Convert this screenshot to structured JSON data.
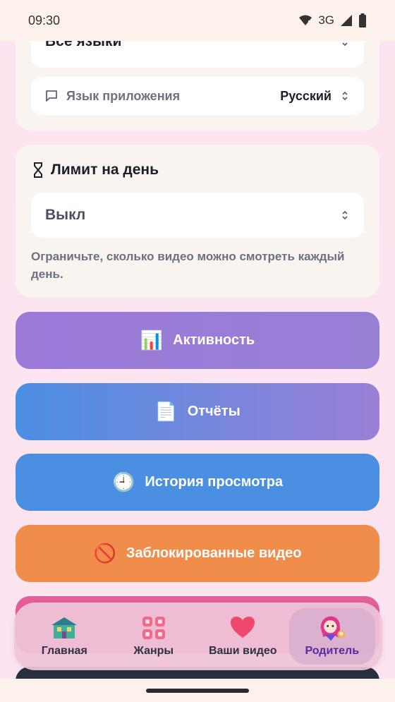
{
  "status_bar": {
    "time": "09:30",
    "network": "3G"
  },
  "language_card": {
    "content_language_value": "Все языки",
    "app_language_label": "Язык приложения",
    "app_language_value": "Русский"
  },
  "limit_card": {
    "title": "Лимит на день",
    "value": "Выкл",
    "hint": "Ограничьте, сколько видео можно смотреть каждый день."
  },
  "buttons": [
    {
      "icon": "📊",
      "label": "Активность",
      "color": "#9B7AD8"
    },
    {
      "icon": "📄",
      "label": "Отчёты",
      "color": "#4B8FE3"
    },
    {
      "icon": "🕘",
      "label": "История просмотра",
      "color": "#4B8FE3"
    },
    {
      "icon": "🚫",
      "label": "Заблокированные видео",
      "color": "#F08D4A"
    }
  ],
  "nav": [
    {
      "label": "Главная",
      "icon": "home-icon",
      "active": false
    },
    {
      "label": "Жанры",
      "icon": "genres-grid-icon",
      "active": false
    },
    {
      "label": "Ваши видео",
      "icon": "heart-icon",
      "active": false
    },
    {
      "label": "Родитель",
      "icon": "parent-avatar-icon",
      "active": true
    }
  ]
}
